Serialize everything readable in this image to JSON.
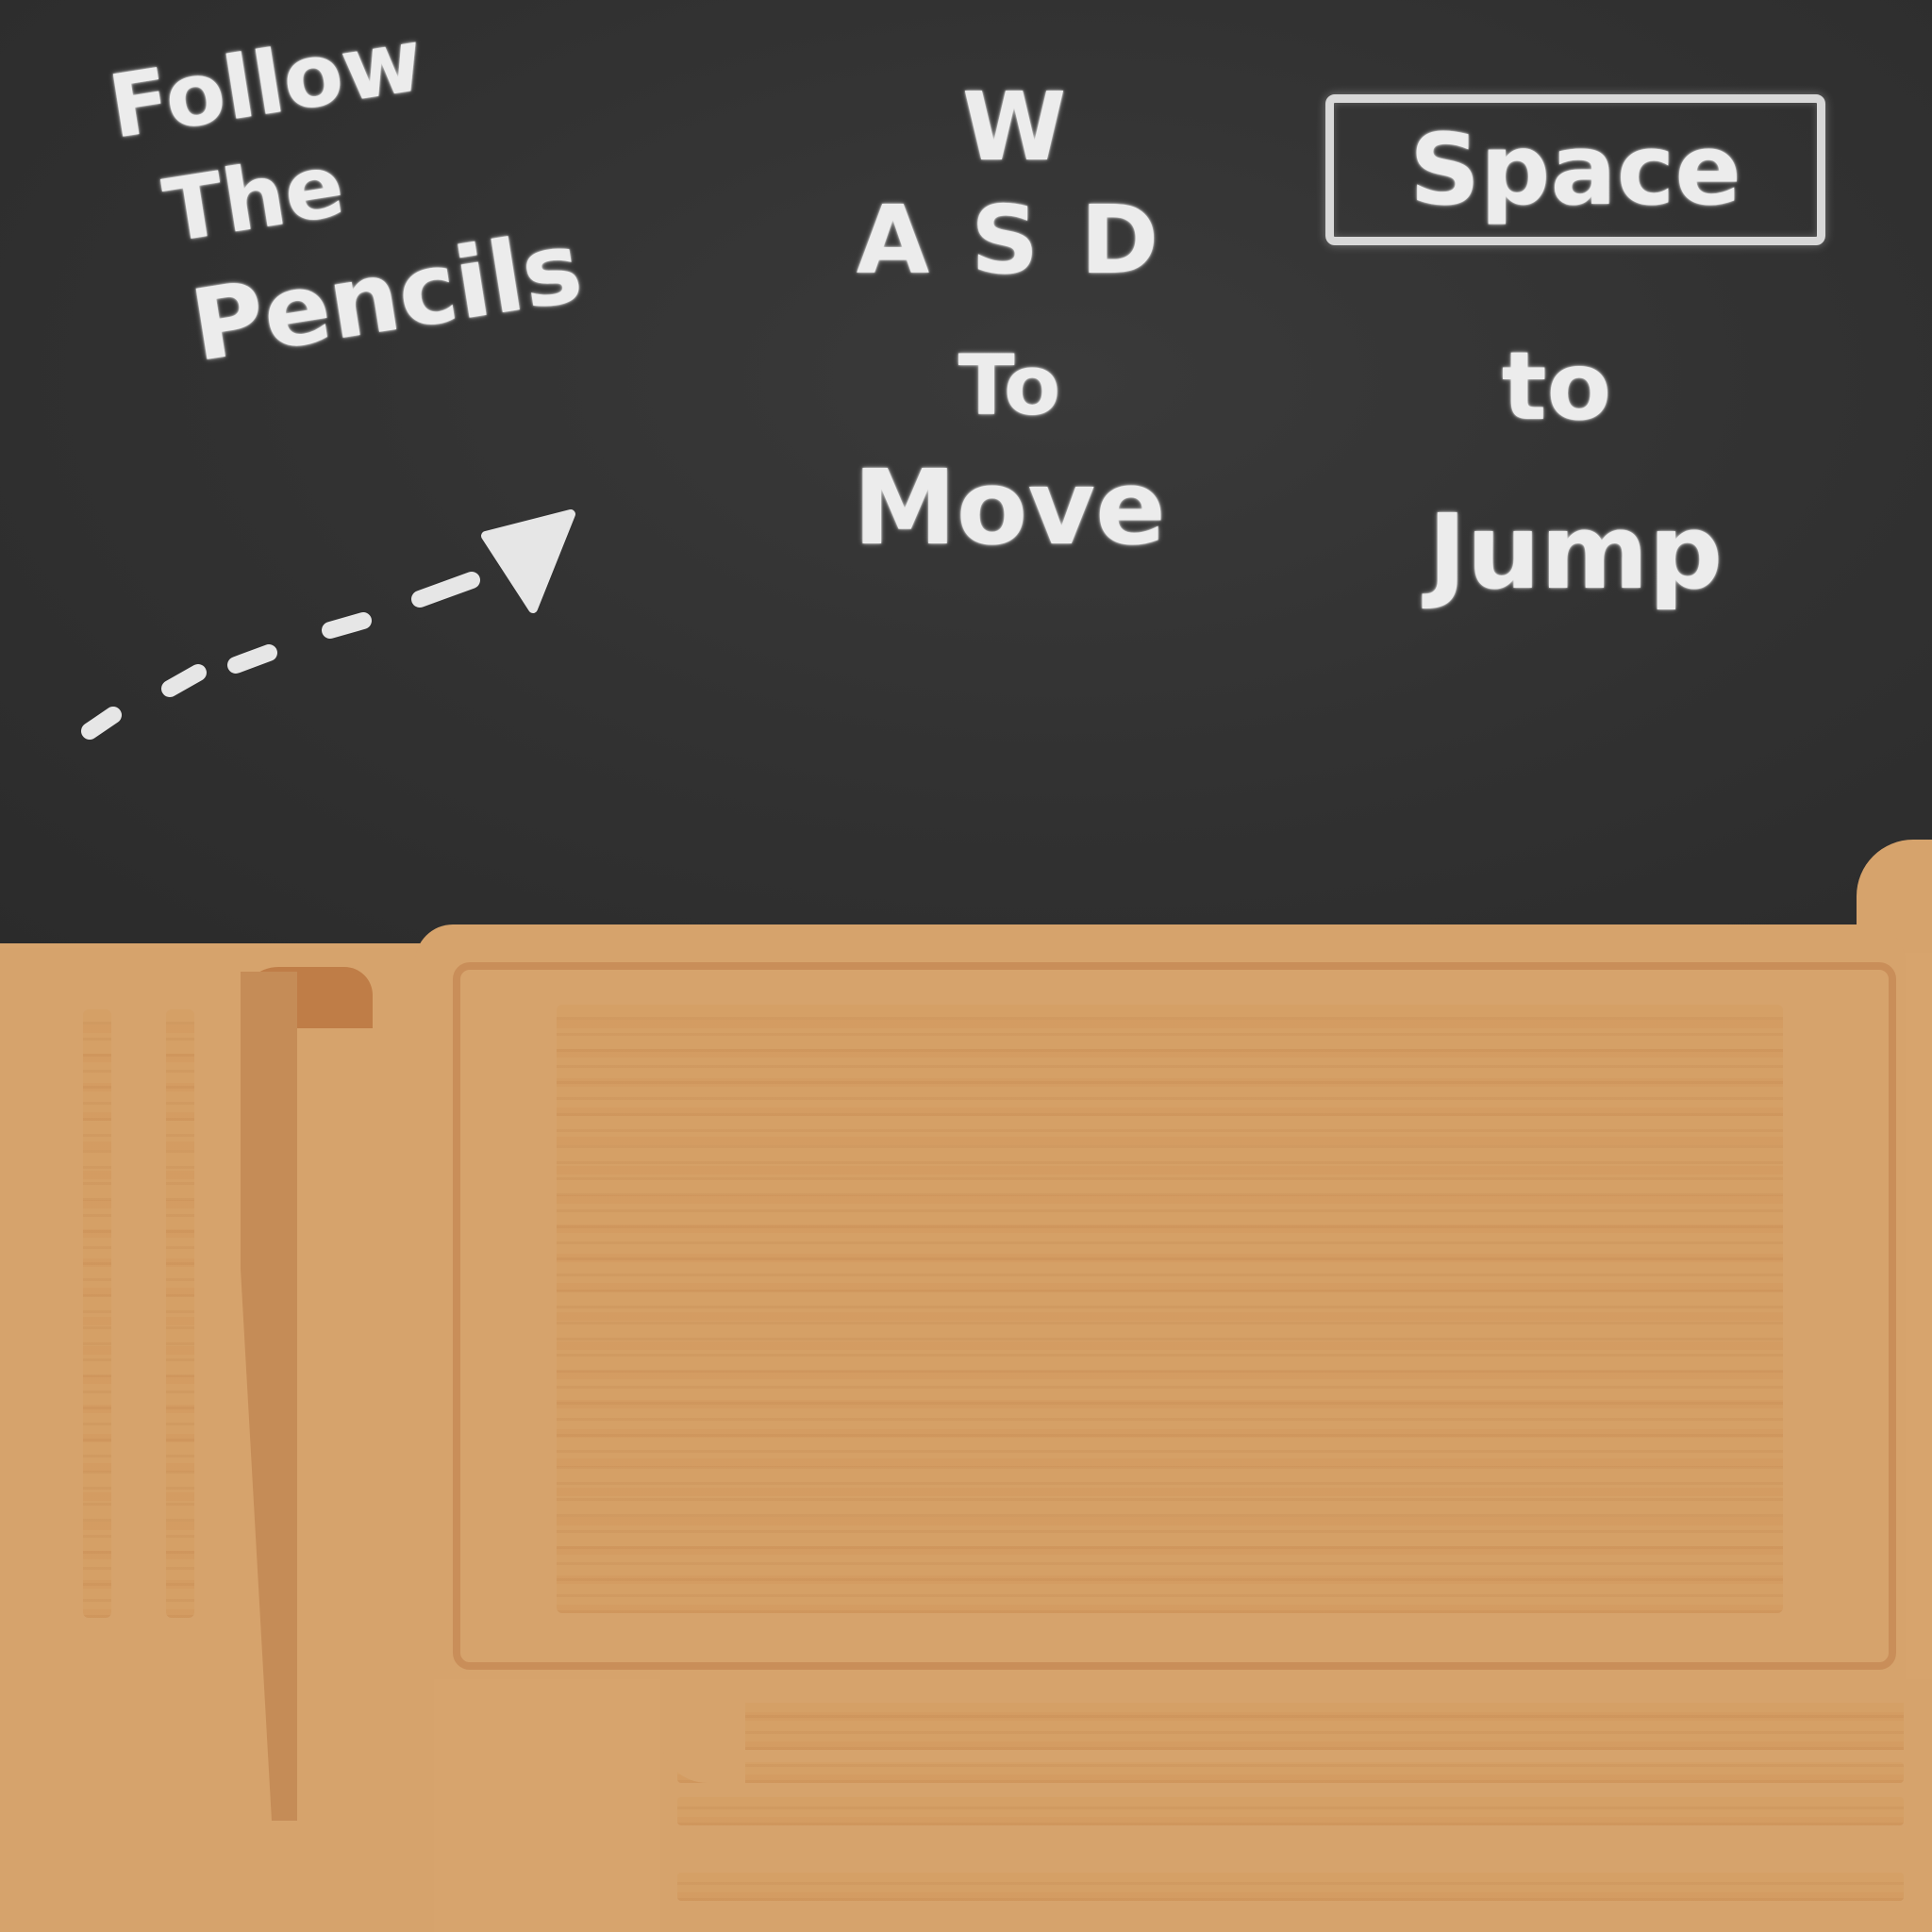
{
  "chalkboard": {
    "follow_hint": {
      "line1": "Follow",
      "line2": "The",
      "line3": "Pencils"
    },
    "move_hint": {
      "key_w": "W",
      "keys_asd": "ASD",
      "to": "To",
      "action": "Move"
    },
    "jump_hint": {
      "key": "Space",
      "to": "to",
      "action": "Jump"
    },
    "arrow_icon": "dashed-arrow-icon"
  },
  "colors": {
    "chalkboard": "#313131",
    "chalk": "#ececec",
    "wood": "#d6a36c",
    "wood_dark": "#bf7d47"
  }
}
